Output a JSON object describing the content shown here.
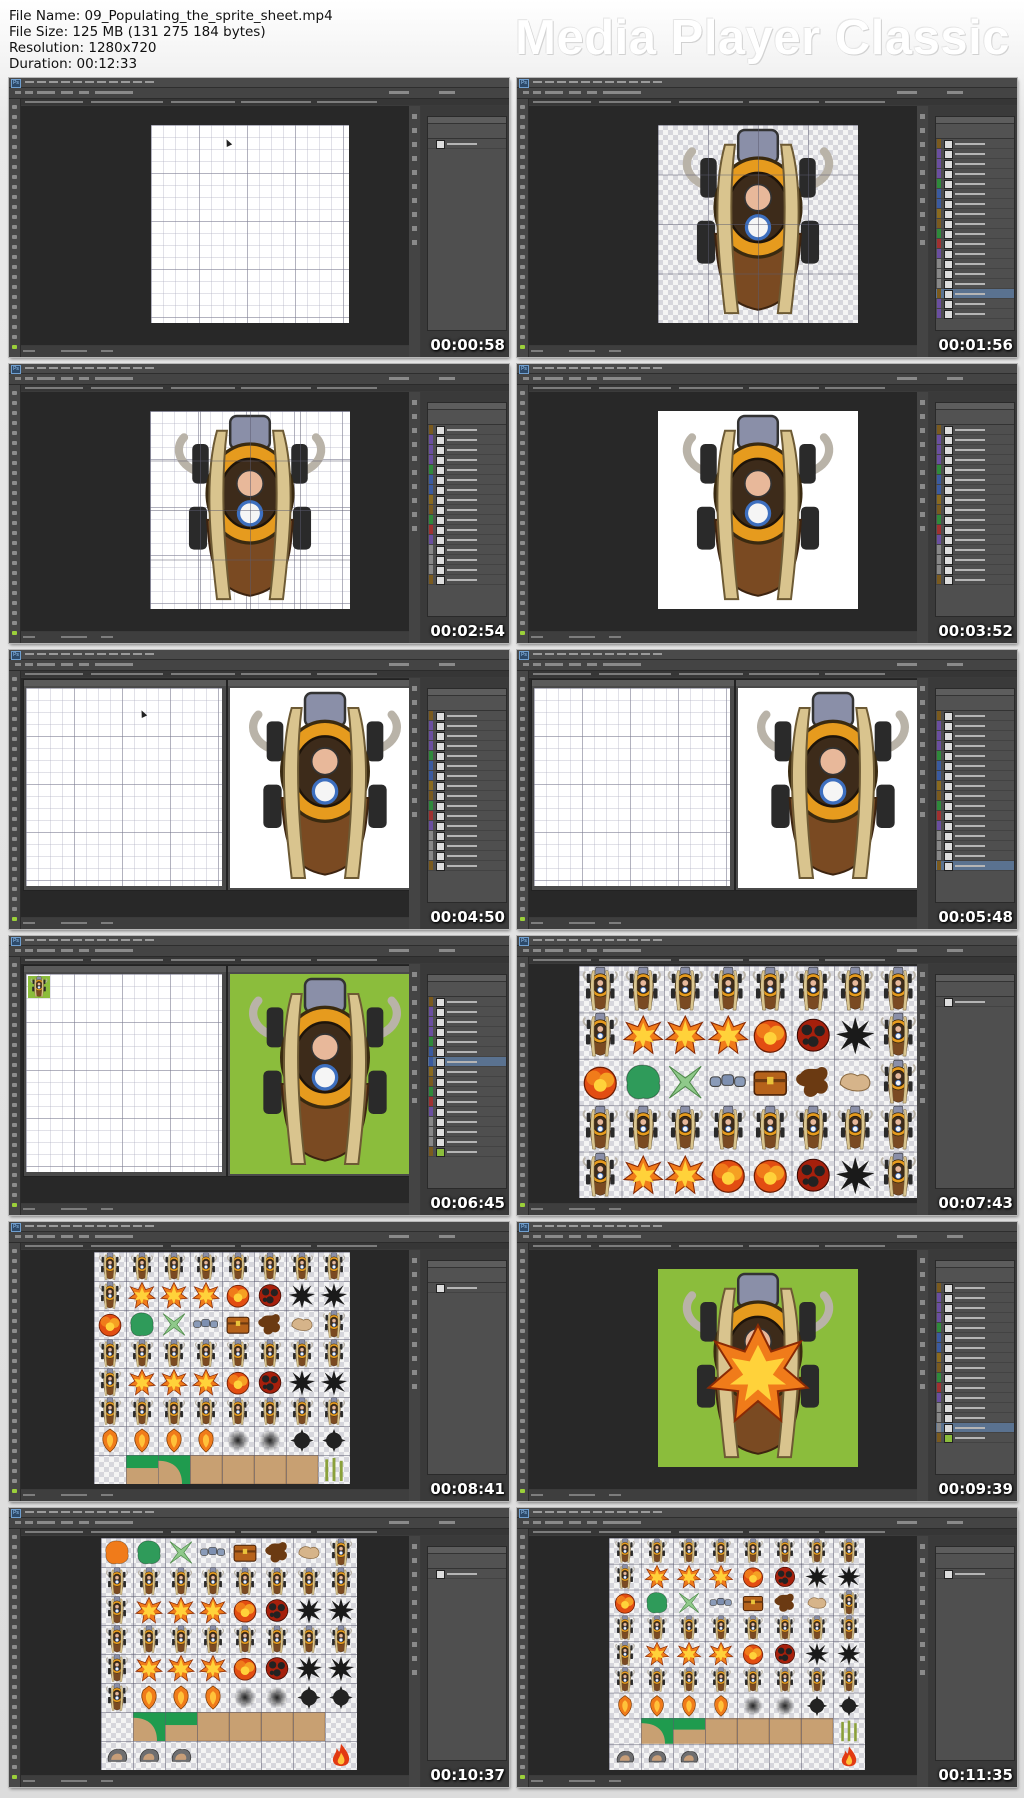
{
  "file_info": {
    "file_name": "File Name: 09_Populating_the_sprite_sheet.mp4",
    "file_size": "File Size: 125 MB (131 275 184 bytes)",
    "resolution": "Resolution: 1280x720",
    "duration": "Duration: 00:12:33"
  },
  "brand": "Media Player Classic",
  "app": {
    "logo": "Ps"
  },
  "thumbnails": [
    {
      "timestamp": "00:00:58",
      "scene": "blank-grid-canvas"
    },
    {
      "timestamp": "00:01:56",
      "scene": "tank-sprite-on-transparent-with-grid"
    },
    {
      "timestamp": "00:02:54",
      "scene": "tank-sprite-with-grid"
    },
    {
      "timestamp": "00:03:52",
      "scene": "tank-sprite-on-white"
    },
    {
      "timestamp": "00:04:50",
      "scene": "two-documents-blank-and-tank"
    },
    {
      "timestamp": "00:05:48",
      "scene": "two-documents-blank-and-tank"
    },
    {
      "timestamp": "00:06:45",
      "scene": "two-documents-blank-and-green-tank"
    },
    {
      "timestamp": "00:07:43",
      "scene": "sprite-sheet-zoomed"
    },
    {
      "timestamp": "00:08:41",
      "scene": "sprite-sheet-full"
    },
    {
      "timestamp": "00:09:39",
      "scene": "tank-explosion-on-green"
    },
    {
      "timestamp": "00:10:37",
      "scene": "sprite-sheet-with-tiles"
    },
    {
      "timestamp": "00:11:35",
      "scene": "sprite-sheet-with-tiles"
    }
  ],
  "colors": {
    "wood": "#d9c48e",
    "barrel": "#8a8fa8",
    "gold": "#e69b1e",
    "hair": "#7a4a22",
    "skin": "#e8b89a",
    "explosion_orange": "#f07b1a",
    "explosion_yellow": "#ffd23a",
    "green_bg": "#8bbd3c",
    "splat_black": "#1a1a1a",
    "smoke_green": "#2f9b5a",
    "leaf_green": "#8fc98a",
    "grass_green": "#1f9b4e",
    "tile_tan": "#c8a072"
  }
}
